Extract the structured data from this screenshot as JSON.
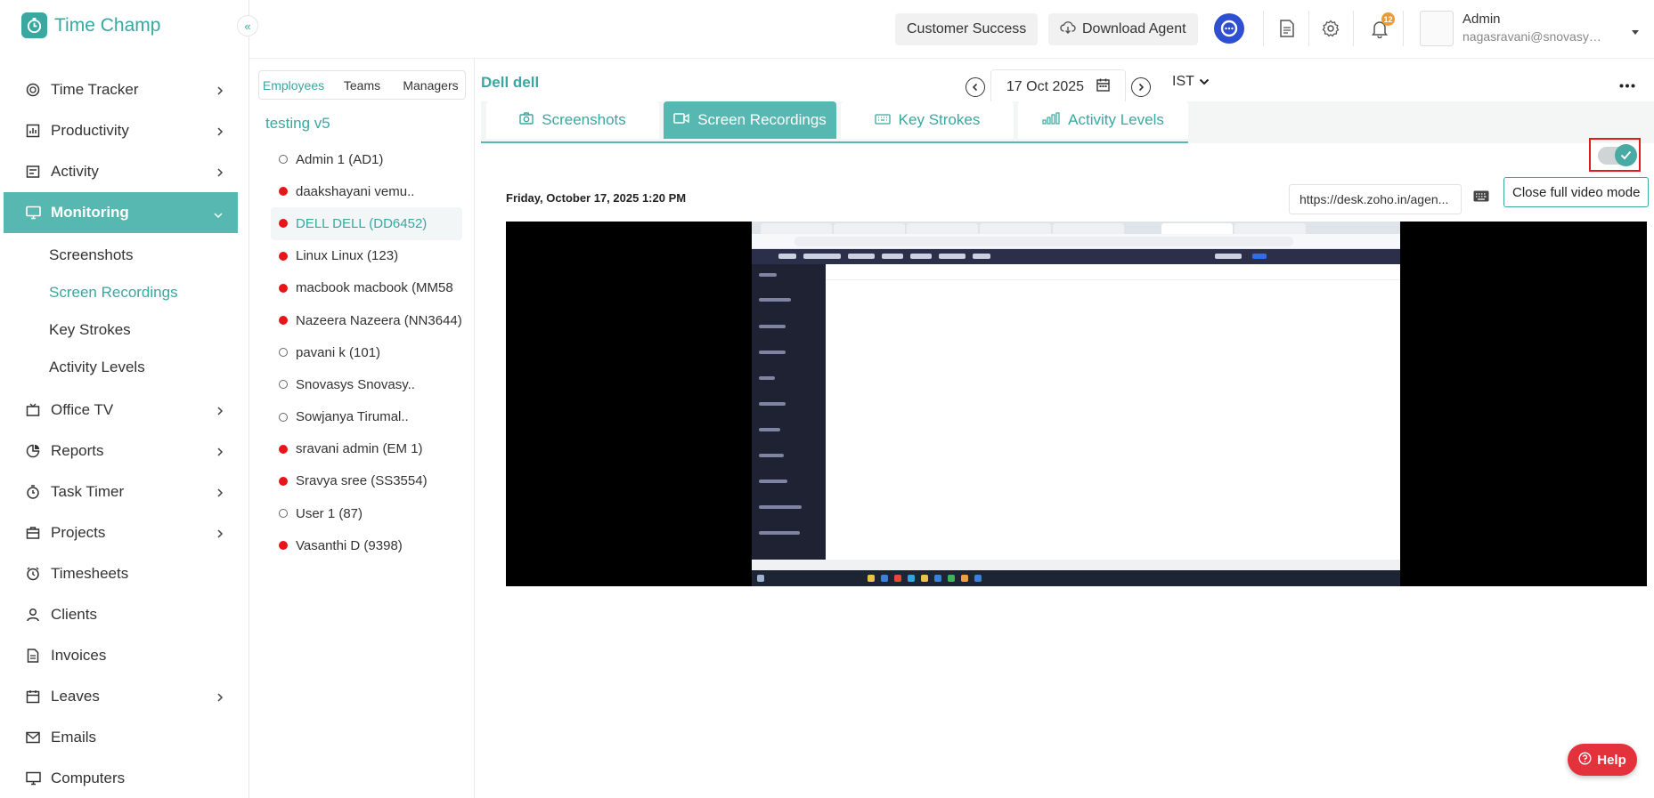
{
  "app": {
    "name": "Time Champ",
    "brand_color": "#3aa7a0"
  },
  "sidebar": {
    "items": [
      {
        "label": "Time Tracker",
        "icon": "time-tracker-icon",
        "has_submenu": true
      },
      {
        "label": "Productivity",
        "icon": "productivity-icon",
        "has_submenu": true
      },
      {
        "label": "Activity",
        "icon": "activity-icon",
        "has_submenu": true
      },
      {
        "label": "Monitoring",
        "icon": "monitor-icon",
        "has_submenu": true,
        "active": true
      },
      {
        "label": "Office TV",
        "icon": "tv-icon",
        "has_submenu": true
      },
      {
        "label": "Reports",
        "icon": "reports-icon",
        "has_submenu": true
      },
      {
        "label": "Task Timer",
        "icon": "task-timer-icon",
        "has_submenu": true
      },
      {
        "label": "Projects",
        "icon": "projects-icon",
        "has_submenu": true
      },
      {
        "label": "Timesheets",
        "icon": "timesheets-icon",
        "has_submenu": false
      },
      {
        "label": "Clients",
        "icon": "clients-icon",
        "has_submenu": false
      },
      {
        "label": "Invoices",
        "icon": "invoices-icon",
        "has_submenu": false
      },
      {
        "label": "Leaves",
        "icon": "leaves-icon",
        "has_submenu": true
      },
      {
        "label": "Emails",
        "icon": "emails-icon",
        "has_submenu": false
      },
      {
        "label": "Computers",
        "icon": "computers-icon",
        "has_submenu": false
      }
    ],
    "monitoring_sub": [
      {
        "label": "Screenshots",
        "active": false
      },
      {
        "label": "Screen Recordings",
        "active": true
      },
      {
        "label": "Key Strokes",
        "active": false
      },
      {
        "label": "Activity Levels",
        "active": false
      }
    ]
  },
  "topbar": {
    "customer_success": "Customer Success",
    "download_agent": "Download Agent",
    "notification_count": "12",
    "user_name": "Admin",
    "user_email": "nagasravani@snovasys.co..."
  },
  "employee_panel": {
    "tabs": [
      "Employees",
      "Teams",
      "Managers"
    ],
    "active_tab": "Employees",
    "group": "testing v5",
    "employees": [
      {
        "name": "Admin 1 (AD1)",
        "status": "offline"
      },
      {
        "name": "daakshayani vemu..",
        "status": "online"
      },
      {
        "name": "DELL DELL (DD6452)",
        "status": "online",
        "selected": true
      },
      {
        "name": "Linux Linux (123)",
        "status": "online"
      },
      {
        "name": "macbook macbook (MM58",
        "status": "online"
      },
      {
        "name": "Nazeera Nazeera (NN3644)",
        "status": "online"
      },
      {
        "name": "pavani k (101)",
        "status": "offline"
      },
      {
        "name": "Snovasys Snovasy..",
        "status": "offline"
      },
      {
        "name": "Sowjanya Tirumal..",
        "status": "offline"
      },
      {
        "name": "sravani admin (EM 1)",
        "status": "online"
      },
      {
        "name": "Sravya sree (SS3554)",
        "status": "online"
      },
      {
        "name": "User 1 (87)",
        "status": "offline"
      },
      {
        "name": "Vasanthi D (9398)",
        "status": "online"
      }
    ]
  },
  "main": {
    "employee_title": "Dell dell",
    "date": "17 Oct 2025",
    "timezone": "IST",
    "tabs": [
      {
        "label": "Screenshots",
        "icon": "camera-icon",
        "active": false
      },
      {
        "label": "Screen Recordings",
        "icon": "video-icon",
        "active": true
      },
      {
        "label": "Key Strokes",
        "icon": "keyboard-icon",
        "active": false
      },
      {
        "label": "Activity Levels",
        "icon": "bar-chart-icon",
        "active": false
      }
    ],
    "full_video_toggle": {
      "on": true
    },
    "recording_timestamp": "Friday, October 17, 2025 1:20 PM",
    "recording_url": "https://desk.zoho.in/agen...",
    "close_full_video": "Close full video mode"
  },
  "help": {
    "label": "Help"
  }
}
